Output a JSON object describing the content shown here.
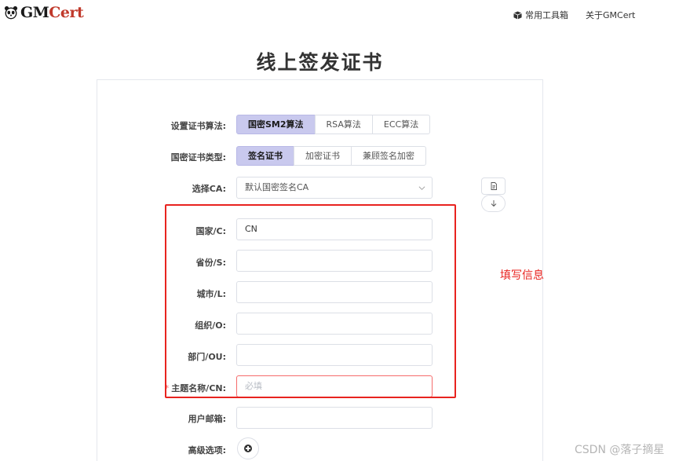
{
  "brand": {
    "gm": "GM",
    "cert": "Cert"
  },
  "nav": {
    "toolbox": "常用工具箱",
    "about": "关于GMCert"
  },
  "title": "线上签发证书",
  "form": {
    "algorithm": {
      "label": "设置证书算法:",
      "options": [
        "国密SM2算法",
        "RSA算法",
        "ECC算法"
      ],
      "selected": 0
    },
    "cert_type": {
      "label": "国密证书类型:",
      "options": [
        "签名证书",
        "加密证书",
        "兼顾签名加密"
      ],
      "selected": 0
    },
    "ca": {
      "label": "选择CA:",
      "value": "默认国密签名CA"
    },
    "country": {
      "label": "国家/C:",
      "value": "CN"
    },
    "province": {
      "label": "省份/S:",
      "value": ""
    },
    "city": {
      "label": "城市/L:",
      "value": ""
    },
    "org": {
      "label": "组织/O:",
      "value": ""
    },
    "dept": {
      "label": "部门/OU:",
      "value": ""
    },
    "subject": {
      "required_mark": "*",
      "label": "主题名称/CN:",
      "placeholder": "必填"
    },
    "email": {
      "label": "用户邮箱:",
      "value": ""
    },
    "advanced": {
      "label": "高级选项:"
    }
  },
  "annotation": "填写信息",
  "watermark": "CSDN @落子摘星",
  "colors": {
    "accent_active": "#c9c9ee",
    "annotation_red": "#e8231f",
    "brand_red": "#c0392b"
  }
}
